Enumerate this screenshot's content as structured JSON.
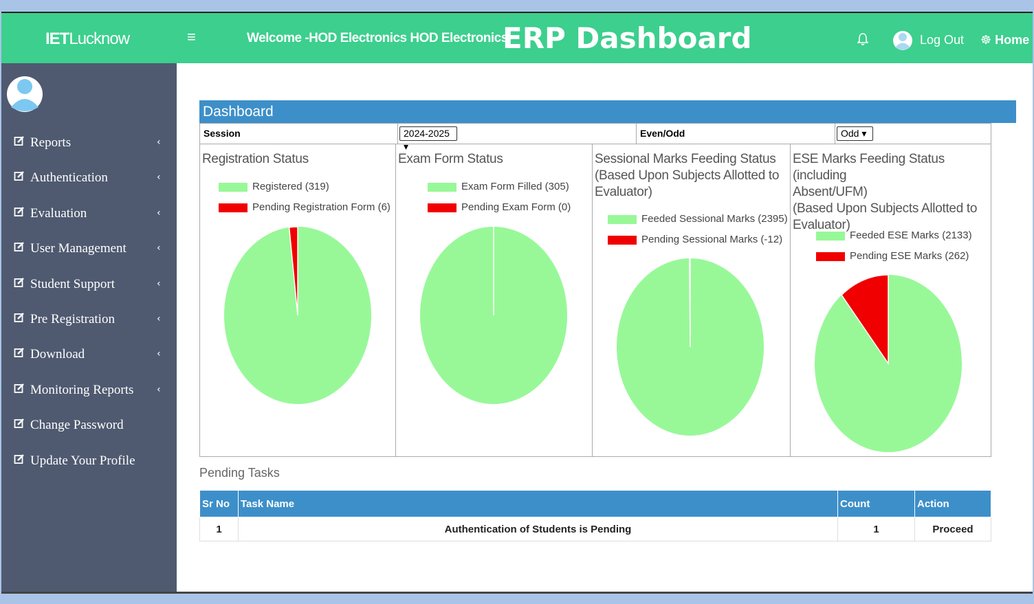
{
  "topbar": {
    "brand_bold": "IET",
    "brand_light": "Lucknow",
    "menu_icon": "hamburger-icon",
    "welcome": "Welcome -HOD Electronics HOD Electronics",
    "title": "ERP Dashboard",
    "bell_icon": "bell-icon",
    "logout": "Log Out",
    "home": "Home",
    "accent": "#3ccf8e"
  },
  "sidebar": {
    "items": [
      {
        "label": "Reports",
        "chevron": "‹"
      },
      {
        "label": "Authentication",
        "chevron": "‹"
      },
      {
        "label": "Evaluation",
        "chevron": "‹"
      },
      {
        "label": "User Management",
        "chevron": "‹"
      },
      {
        "label": "Student Support",
        "chevron": "‹"
      },
      {
        "label": "Pre Registration",
        "chevron": "‹"
      },
      {
        "label": "Download",
        "chevron": "‹"
      },
      {
        "label": "Monitoring Reports",
        "chevron": "‹"
      },
      {
        "label": "Change Password",
        "chevron": ""
      },
      {
        "label": "Update Your Profile",
        "chevron": ""
      }
    ],
    "item_icon": "edit-icon",
    "background": "#4f5a70"
  },
  "dashboard": {
    "header": "Dashboard",
    "session_label": "Session",
    "session_value": "2024-2025",
    "evenodd_label": "Even/Odd",
    "evenodd_value": "Odd"
  },
  "colors": {
    "done": "#98f898",
    "pending": "#f00000",
    "table_header": "#3d8fc9"
  },
  "chart_data": [
    {
      "type": "pie",
      "title": "Registration Status",
      "categories": [
        "Registered (319)",
        "Pending Registration Form (6)"
      ],
      "values": [
        319,
        6
      ]
    },
    {
      "type": "pie",
      "title": "Exam Form Status",
      "categories": [
        "Exam Form Filled (305)",
        "Pending Exam Form (0)"
      ],
      "values": [
        305,
        0
      ]
    },
    {
      "type": "pie",
      "title": "Sessional Marks Feeding Status (Based Upon Subjects Allotted to Evaluator)",
      "categories": [
        "Feeded Sessional Marks (2395)",
        "Pending Sessional Marks (-12)"
      ],
      "values": [
        2395,
        -12
      ]
    },
    {
      "type": "pie",
      "title": "ESE Marks Feeding Status (including Absent/UFM) (Based Upon Subjects Allotted to Evaluator)",
      "categories": [
        "Feeded ESE Marks (2133)",
        "Pending ESE Marks (262)"
      ],
      "values": [
        2133,
        262
      ]
    }
  ],
  "pending": {
    "label": "Pending Tasks",
    "columns": [
      "Sr No",
      "Task Name",
      "Count",
      "Action"
    ],
    "rows": [
      {
        "sr": "1",
        "task": "Authentication of Students is Pending",
        "count": "1",
        "action": "Proceed"
      }
    ]
  }
}
